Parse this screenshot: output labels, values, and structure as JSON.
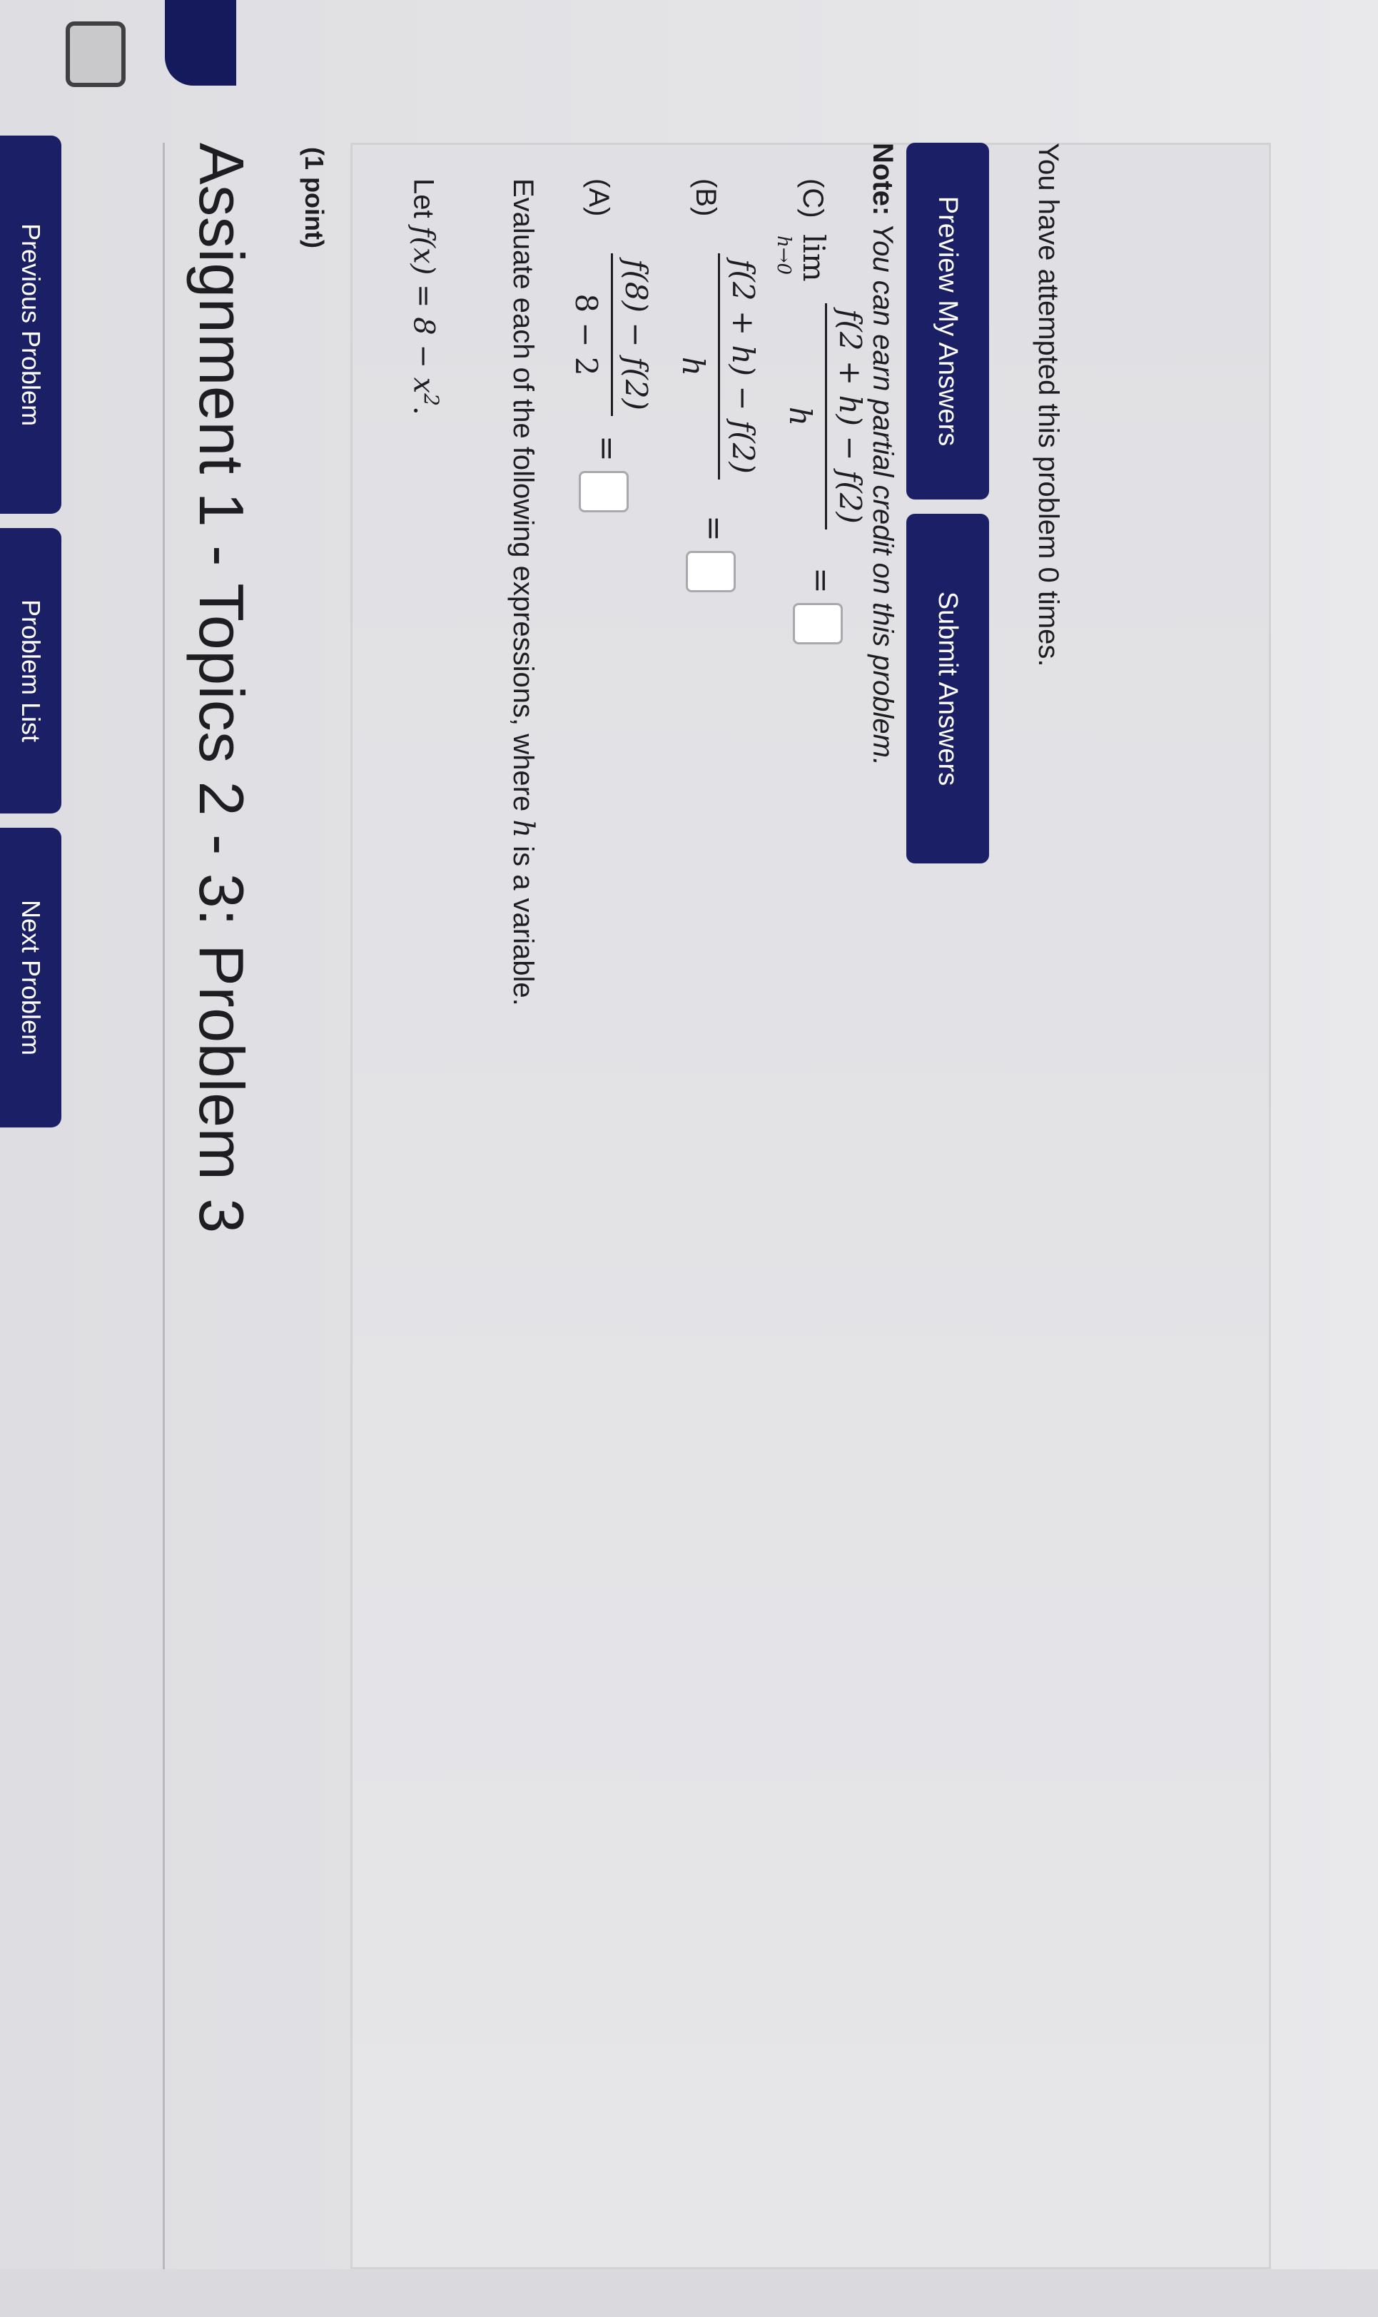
{
  "nav": {
    "previous": "Previous Problem",
    "list": "Problem List",
    "next": "Next Problem"
  },
  "title": "Assignment 1 - Topics 2 - 3: Problem 3",
  "points": "(1 point)",
  "problem": {
    "statement_prefix": "Let ",
    "statement_math": "f(x) = 8 − x",
    "statement_exp": "2",
    "statement_suffix": ".",
    "instruction_pre": "Evaluate each of the following expressions, where ",
    "instruction_var": "h",
    "instruction_post": " is a variable.",
    "parts": [
      {
        "label": "(A)",
        "numerator": "f(8) − f(2)",
        "denominator": "8 − 2",
        "equals": "="
      },
      {
        "label": "(B)",
        "numerator": "f(2 + h) − f(2)",
        "denominator": "h",
        "equals": "="
      },
      {
        "label": "(C)",
        "limit": "lim",
        "limit_sub": "h→0",
        "numerator": "f(2 + h) − f(2)",
        "denominator": "h",
        "equals": "="
      }
    ]
  },
  "note": {
    "label": "Note:",
    "text": " You can earn partial credit on this problem."
  },
  "buttons": {
    "preview": "Preview My Answers",
    "submit": "Submit Answers"
  },
  "attempts": "You have attempted this problem 0 times.",
  "colors": {
    "nav_blue": "#1a1f66",
    "background": "#e7e7e9",
    "text": "#1e1e22"
  }
}
